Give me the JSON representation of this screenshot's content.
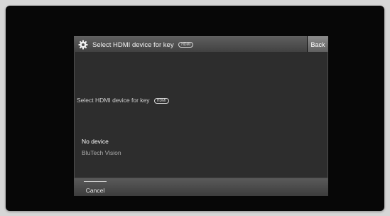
{
  "dialog": {
    "title": "Select HDMI device for key",
    "title_key_badge": "HDMI",
    "back_label": "Back",
    "prompt": "Select HDMI device for key",
    "prompt_key_badge": "HDMI",
    "options": [
      {
        "label": "No device",
        "selected": true
      },
      {
        "label": "BluTech Vision",
        "selected": false
      }
    ],
    "cancel_label": "Cancel"
  },
  "icons": {
    "title": "gear-icon",
    "key_badge": "hdmi-key-icon"
  }
}
